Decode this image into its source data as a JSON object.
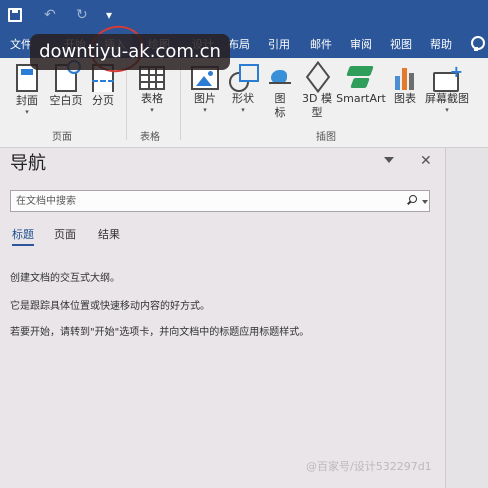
{
  "title_bar": {
    "bg_color": "#2b579a",
    "quick_access": [
      "save-icon",
      "undo-icon",
      "redo-icon",
      "customize-icon"
    ]
  },
  "tabs": [
    {
      "label": "文件"
    },
    {
      "label": "开始"
    },
    {
      "label": "插入",
      "active": true
    },
    {
      "label": "绘图"
    },
    {
      "label": "设计"
    },
    {
      "label": "布局"
    },
    {
      "label": "引用"
    },
    {
      "label": "邮件"
    },
    {
      "label": "审阅"
    },
    {
      "label": "视图"
    },
    {
      "label": "帮助"
    }
  ],
  "watermark": {
    "text": "downtiyu-ak.com.cn"
  },
  "ribbon": {
    "groups": [
      {
        "label": "页面",
        "buttons": [
          {
            "label": "封面",
            "icon": "cover-page-icon"
          },
          {
            "label": "空白页",
            "icon": "blank-page-icon"
          },
          {
            "label": "分页",
            "icon": "page-break-icon"
          }
        ]
      },
      {
        "label": "表格",
        "buttons": [
          {
            "label": "表格",
            "icon": "table-icon"
          }
        ]
      },
      {
        "label": "插图",
        "buttons": [
          {
            "label": "图片",
            "icon": "picture-icon"
          },
          {
            "label": "形状",
            "icon": "shapes-icon"
          },
          {
            "label": "图",
            "label2": "标",
            "icon": "icons-icon"
          },
          {
            "label": "3D 模",
            "label2": "型",
            "icon": "3d-model-icon"
          },
          {
            "label": "SmartArt",
            "icon": "smartart-icon"
          },
          {
            "label": "图表",
            "icon": "chart-icon"
          },
          {
            "label": "屏幕截图",
            "icon": "screenshot-icon"
          }
        ]
      }
    ]
  },
  "nav_pane": {
    "title": "导航",
    "search_placeholder": "在文档中搜索",
    "tabs": [
      {
        "label": "标题",
        "active": true
      },
      {
        "label": "页面"
      },
      {
        "label": "结果"
      }
    ],
    "lines": [
      "创建文档的交互式大纲。",
      "它是跟踪具体位置或快速移动内容的好方式。",
      "若要开始，请转到\"开始\"选项卡，并向文档中的标题应用标题样式。"
    ]
  },
  "footer_watermark": "@百家号/设计532297d1"
}
